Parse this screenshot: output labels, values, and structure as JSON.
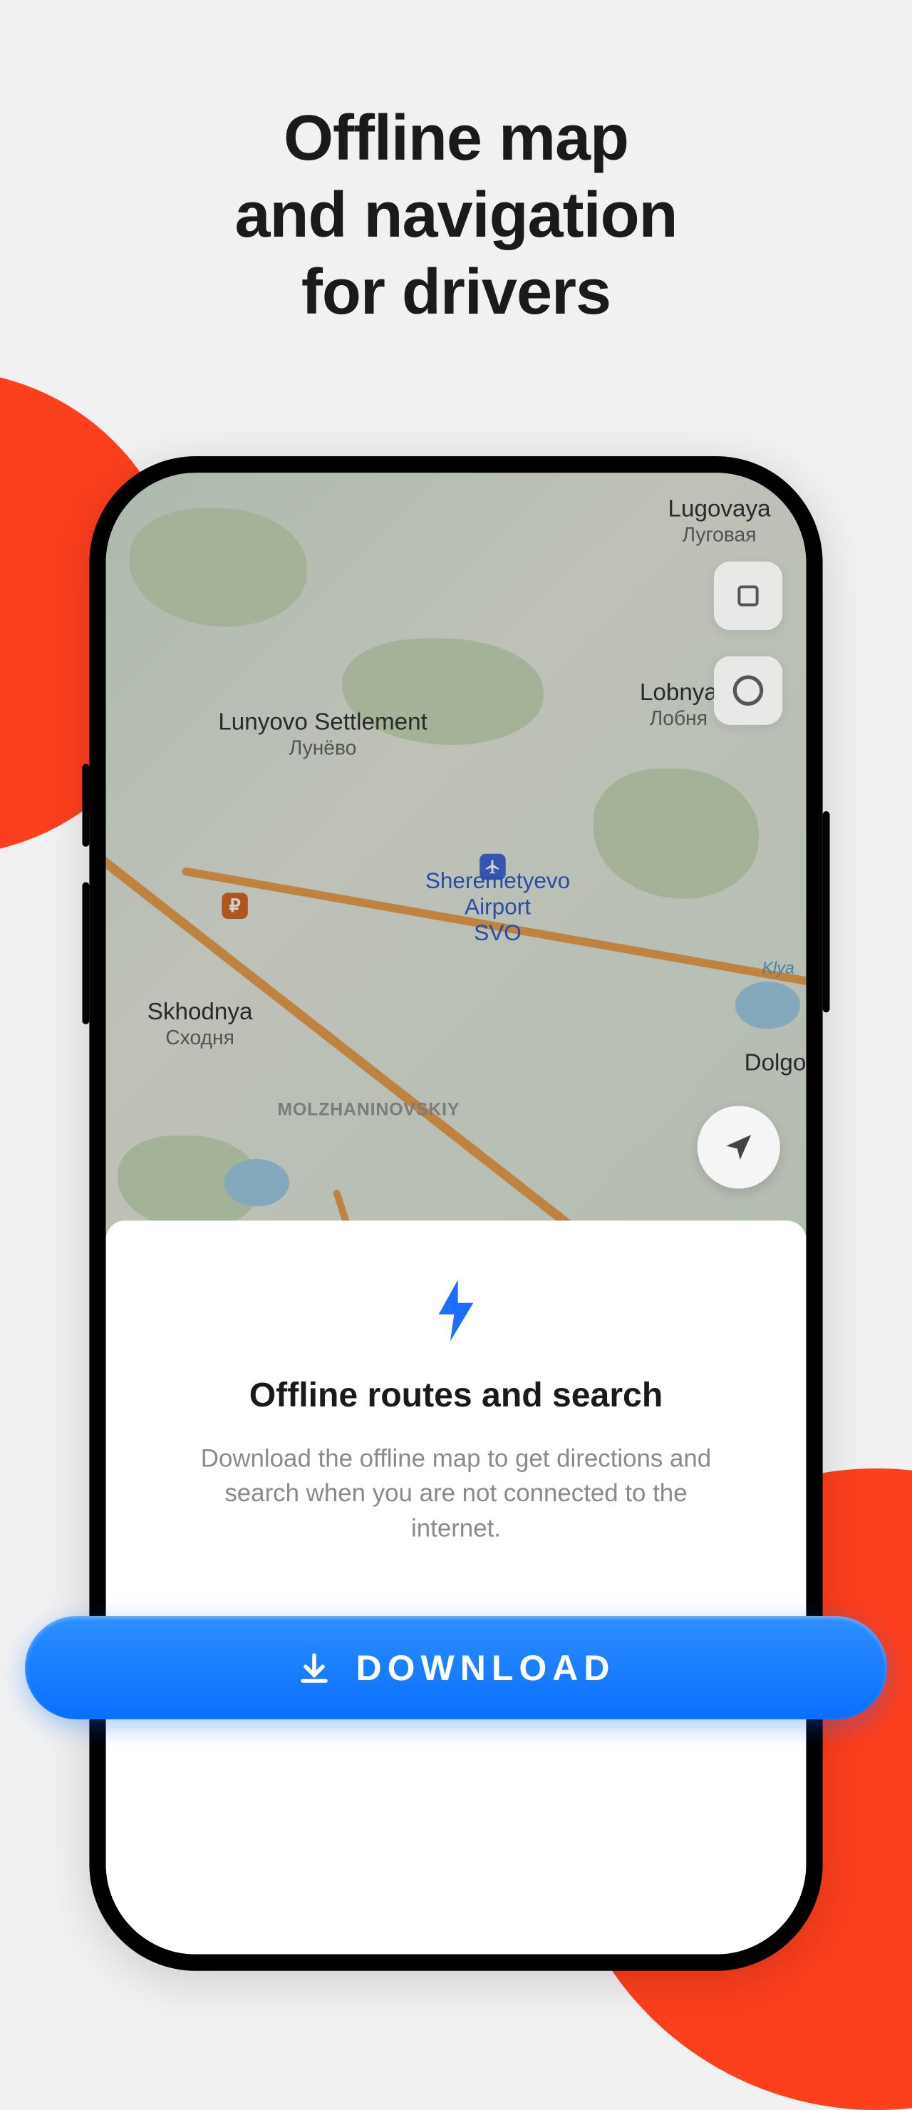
{
  "headline": {
    "line1": "Offline map",
    "line2": "and navigation",
    "line3": "for drivers"
  },
  "map": {
    "labels": {
      "lugovaya": {
        "en": "Lugovaya",
        "ru": "Луговая"
      },
      "lunyovo": {
        "en": "Lunyovo Settlement",
        "ru": "Лунёво"
      },
      "lobnya": {
        "en": "Lobnya",
        "ru": "Лобня"
      },
      "svo": {
        "line1": "Sheremetyevo",
        "line2": "Airport",
        "line3": "SVO"
      },
      "skhodnya": {
        "en": "Skhodnya",
        "ru": "Сходня"
      },
      "dolgo": {
        "en": "Dolgo"
      },
      "district": "MOLZHANINOVSKIY",
      "river": "Klya"
    },
    "ruble_symbol": "₽"
  },
  "card": {
    "title": "Offline routes and search",
    "description": "Download the offline map to get directions and search when you are not connected to the internet."
  },
  "download_button": "DOWNLOAD"
}
